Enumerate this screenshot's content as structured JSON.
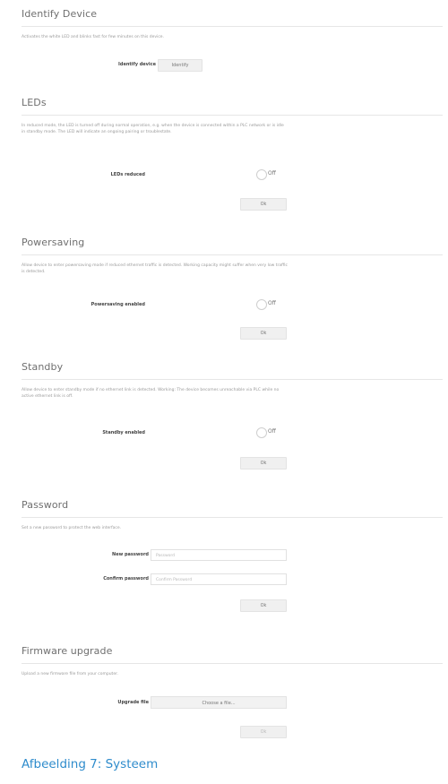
{
  "identify": {
    "title": "Identify Device",
    "desc": "Activates the white LED and blinks fast for few minutes on this device.",
    "label": "Identify device",
    "button": "Identify"
  },
  "leds": {
    "title": "LEDs",
    "desc": "In reduced mode, the LED is turned off during normal operation, e.g. when the device is connected within a PLC network or is idle in standby mode. The LED will indicate an ongoing pairing or troublestate.",
    "label": "LEDs reduced",
    "toggle": "Off",
    "button": "Ok"
  },
  "powersaving": {
    "title": "Powersaving",
    "desc": "Allow device to enter powersaving mode if reduced ethernet traffic is detected. Working capacity might suffer when very low traffic is detected.",
    "label": "Powersaving enabled",
    "toggle": "Off",
    "button": "Ok"
  },
  "standby": {
    "title": "Standby",
    "desc": "Allow device to enter standby mode if no ethernet link is detected. Working: The device becomes unreachable via PLC while no active ethernet link is off.",
    "label": "Standby enabled",
    "toggle": "Off",
    "button": "Ok"
  },
  "password": {
    "title": "Password",
    "desc": "Set a new password to protect the web interface.",
    "new_label": "New password",
    "new_placeholder": "Password",
    "confirm_label": "Confirm password",
    "confirm_placeholder": "Confirm Password",
    "button": "Ok"
  },
  "firmware": {
    "title": "Firmware upgrade",
    "desc": "Upload a new firmware file from your computer.",
    "label": "Upgrade file",
    "file_button": "Choose a file...",
    "button": "Ok"
  },
  "caption": "Afbeelding 7: Systeem"
}
